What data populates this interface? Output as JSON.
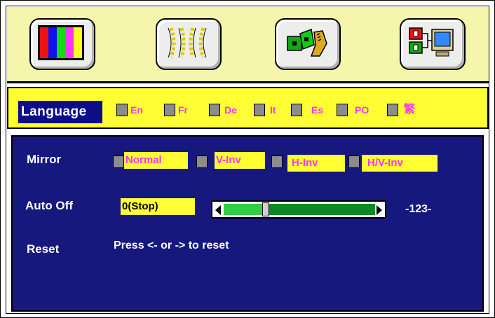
{
  "toolbar": {
    "icons": [
      {
        "name": "color-bars-icon"
      },
      {
        "name": "geometry-icon"
      },
      {
        "name": "tools-icon"
      },
      {
        "name": "input-pc-icon"
      }
    ]
  },
  "language": {
    "label": "Language",
    "options": [
      "En",
      "Fr",
      "De",
      "It",
      "Es",
      "PO",
      "繁"
    ]
  },
  "mirror": {
    "label": "Mirror",
    "options": [
      "Normal",
      "V-Inv",
      "H-Inv",
      "H/V-Inv"
    ]
  },
  "auto_off": {
    "label": "Auto Off",
    "value": "0(Stop)",
    "slider_value": "-123-",
    "slider_fraction": 0.28
  },
  "reset": {
    "label": "Reset",
    "instruction": "Press <- or -> to reset"
  },
  "colors": {
    "menu_blue": "#17187e",
    "highlight_yellow": "#ffff33",
    "option_magenta": "#ff33ff"
  }
}
